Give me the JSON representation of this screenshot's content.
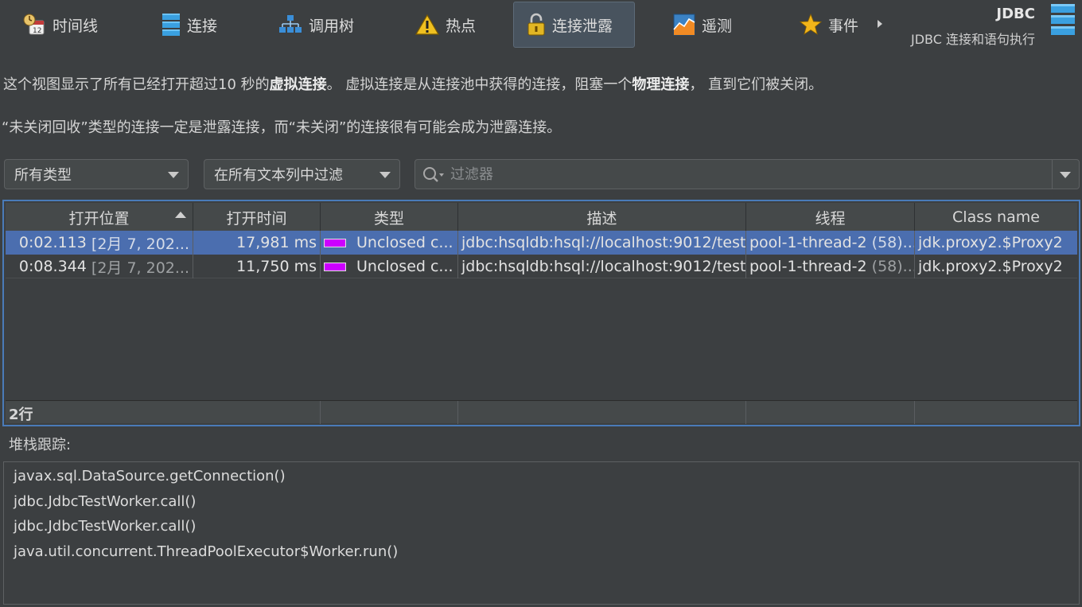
{
  "toolbar": {
    "tabs": [
      {
        "label": "时间线",
        "icon": "timeline-clock-icon"
      },
      {
        "label": "连接",
        "icon": "connection-stack-icon"
      },
      {
        "label": "调用树",
        "icon": "call-tree-icon"
      },
      {
        "label": "热点",
        "icon": "hotspot-warning-icon"
      },
      {
        "label": "连接泄露",
        "icon": "lock-icon",
        "active": true
      },
      {
        "label": "遥测",
        "icon": "telemetry-chart-icon"
      },
      {
        "label": "事件",
        "icon": "star-icon"
      }
    ],
    "title": "JDBC",
    "subtitle": "JDBC 连接和语句执行"
  },
  "description": {
    "line1_a": "这个视图显示了所有已经打开超过10 秒的",
    "line1_b": "虚拟连接",
    "line1_c": "。 虚拟连接是从连接池中获得的连接，阻塞一个",
    "line1_d": "物理连接",
    "line1_e": "， 直到它们被关闭。",
    "line2": "“未关闭回收”类型的连接一定是泄露连接，而“未关闭”的连接很有可能会成为泄露连接。"
  },
  "filters": {
    "type_select": "所有类型",
    "column_select": "在所有文本列中过滤",
    "search_placeholder": "过滤器"
  },
  "table": {
    "columns": [
      "打开位置",
      "打开时间",
      "类型",
      "描述",
      "线程",
      "Class name"
    ],
    "rows": [
      {
        "open_pos": "0:02.113",
        "open_date": "[2月 7, 202...",
        "open_time": "17,981 ms",
        "type": "Unclosed c...",
        "type_color": "#cc00ff",
        "desc": "jdbc:hsqldb:hsql://localhost:9012/test",
        "thread": "pool-1-thread-2",
        "thread_id": "(58)...",
        "class_name": "jdk.proxy2.$Proxy2",
        "selected": true
      },
      {
        "open_pos": "0:08.344",
        "open_date": "[2月 7, 202...",
        "open_time": "11,750 ms",
        "type": "Unclosed c...",
        "type_color": "#cc00ff",
        "desc": "jdbc:hsqldb:hsql://localhost:9012/test",
        "thread": "pool-1-thread-2",
        "thread_id": "(58)...",
        "class_name": "jdk.proxy2.$Proxy2",
        "selected": false
      }
    ],
    "row_count": "2行"
  },
  "stack": {
    "label": "堆栈跟踪:",
    "frames": [
      "javax.sql.DataSource.getConnection()",
      "jdbc.JdbcTestWorker.call()",
      "jdbc.JdbcTestWorker.call()",
      "java.util.concurrent.ThreadPoolExecutor$Worker.run()"
    ]
  }
}
